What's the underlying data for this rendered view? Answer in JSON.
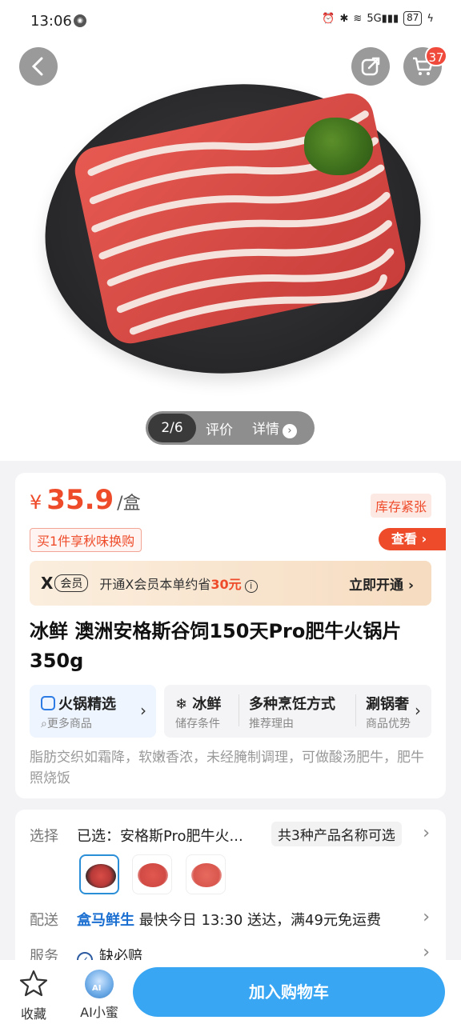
{
  "status": {
    "time": "13:06",
    "battery": "87",
    "signal": "5G"
  },
  "hero": {
    "pager": {
      "current": "2/6",
      "tab_reviews": "评价",
      "tab_details": "详情"
    },
    "cart_count": "37"
  },
  "price": {
    "currency": "¥",
    "value": "35.9",
    "unit": "/盒",
    "stock": "库存紧张"
  },
  "promo": {
    "text": "买1件享秋味换购",
    "view": "查看"
  },
  "vip": {
    "logo": "X",
    "tag": "会员",
    "text_prefix": "开通X会员本单约省",
    "saving": "30元",
    "open": "立即开通"
  },
  "product": {
    "title": "冰鲜 澳洲安格斯谷饲150天Pro肥牛火锅片 350g",
    "description": "脂肪交织如霜降，软嫩香浓，未经腌制调理，可做酸汤肥牛，肥牛照烧饭"
  },
  "features": {
    "hotpot": {
      "label": "火锅精选",
      "sub": "更多商品"
    },
    "fresh": {
      "label": "冰鲜",
      "sub": "储存条件"
    },
    "cooking": {
      "label": "多种烹饪方式",
      "sub": "推荐理由"
    },
    "shabu": {
      "label": "涮锅奢",
      "sub": "商品优势"
    }
  },
  "select": {
    "label": "选择",
    "selected": "已选：安格斯Pro肥牛火...",
    "count_tag": "共3种产品名称可选"
  },
  "delivery": {
    "label": "配送",
    "brand": "盒马鲜生",
    "text": " 最快今日 13:30 送达，满49元免运费"
  },
  "service": {
    "label": "服务",
    "text": "缺必赔"
  },
  "bottom": {
    "favorite": "收藏",
    "ai": "AI小蜜",
    "ai_badge": "AI",
    "add_to_cart": "加入购物车"
  }
}
